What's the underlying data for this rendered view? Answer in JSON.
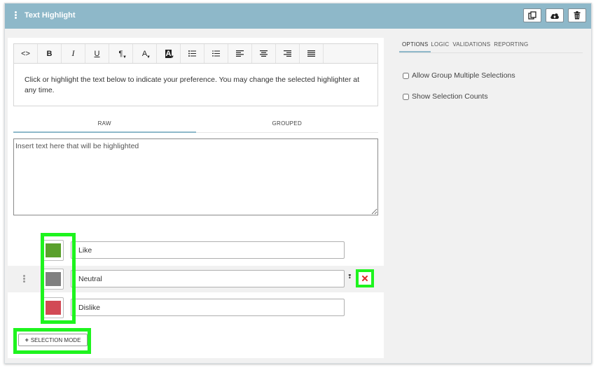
{
  "header": {
    "title": "Text Highlight",
    "buttons": [
      "copy-icon",
      "cloud-upload-icon",
      "trash-icon"
    ]
  },
  "editor": {
    "toolbar": [
      {
        "name": "code-view",
        "label": "<>"
      },
      {
        "name": "bold",
        "label": "B"
      },
      {
        "name": "italic",
        "label": "I"
      },
      {
        "name": "underline",
        "label": "U"
      },
      {
        "name": "paragraph",
        "label": "¶"
      },
      {
        "name": "font-color",
        "label": "A"
      },
      {
        "name": "background-color",
        "label": "A"
      },
      {
        "name": "bulleted-list",
        "label": "≔"
      },
      {
        "name": "numbered-list",
        "label": "⒈"
      },
      {
        "name": "align-left",
        "label": "≡"
      },
      {
        "name": "align-center",
        "label": "≡"
      },
      {
        "name": "align-right",
        "label": "≡"
      },
      {
        "name": "justify",
        "label": "≡"
      }
    ],
    "prompt": "Click or highlight the text below to indicate your preference. You may change the selected highlighter at any time."
  },
  "tabs": {
    "raw": "RAW",
    "grouped": "GROUPED"
  },
  "raw_text": {
    "value": "",
    "placeholder": "Insert text here that will be highlighted"
  },
  "highlighters": [
    {
      "label": "Like",
      "color": "#5aa02c"
    },
    {
      "label": "Neutral",
      "color": "#808080"
    },
    {
      "label": "Dislike",
      "color": "#d24a55"
    }
  ],
  "add_button": "SELECTION MODE",
  "right_panel": {
    "tabs": [
      "OPTIONS",
      "LOGIC",
      "VALIDATIONS",
      "REPORTING"
    ],
    "options": [
      {
        "label": "Allow Group Multiple Selections",
        "checked": false
      },
      {
        "label": "Show Selection Counts",
        "checked": false
      }
    ]
  },
  "colors": {
    "header": "#8eb8c9",
    "focus_outline": "#1ef41e",
    "remove": "#e02a2a"
  }
}
